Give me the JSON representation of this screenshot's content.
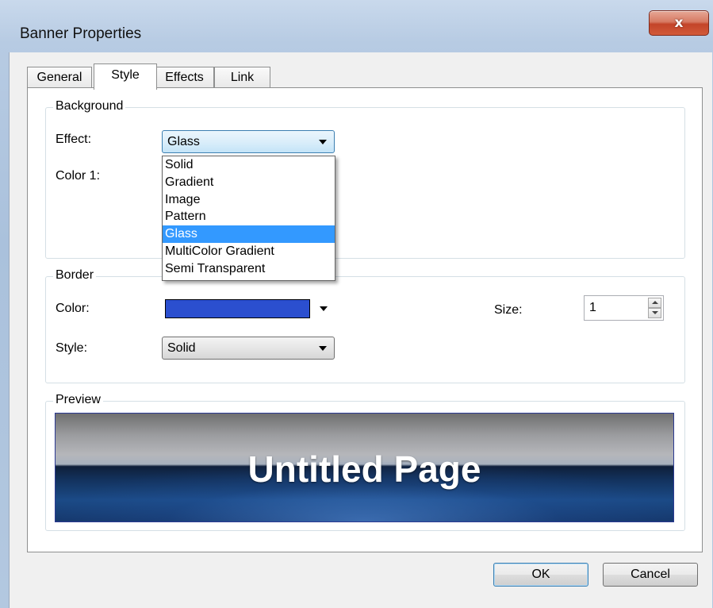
{
  "window": {
    "title": "Banner Properties",
    "close_glyph": "x"
  },
  "tabs": [
    {
      "label": "General"
    },
    {
      "label": "Style"
    },
    {
      "label": "Effects"
    },
    {
      "label": "Link"
    }
  ],
  "background_group": {
    "label": "Background",
    "effect_label": "Effect:",
    "effect_value": "Glass",
    "color1_label": "Color 1:",
    "effect_options": [
      "Solid",
      "Gradient",
      "Image",
      "Pattern",
      "Glass",
      "MultiColor Gradient",
      "Semi Transparent"
    ],
    "selected_option": "Glass"
  },
  "border_group": {
    "label": "Border",
    "color_label": "Color:",
    "color_value": "#2b4fcf",
    "size_label": "Size:",
    "size_value": "1",
    "style_label": "Style:",
    "style_value": "Solid"
  },
  "preview_group": {
    "label": "Preview",
    "banner_text": "Untitled Page"
  },
  "buttons": {
    "ok": "OK",
    "cancel": "Cancel"
  },
  "colors": {
    "selection": "#3399ff",
    "border_color": "#2b4fcf",
    "close_button": "#c34429"
  }
}
